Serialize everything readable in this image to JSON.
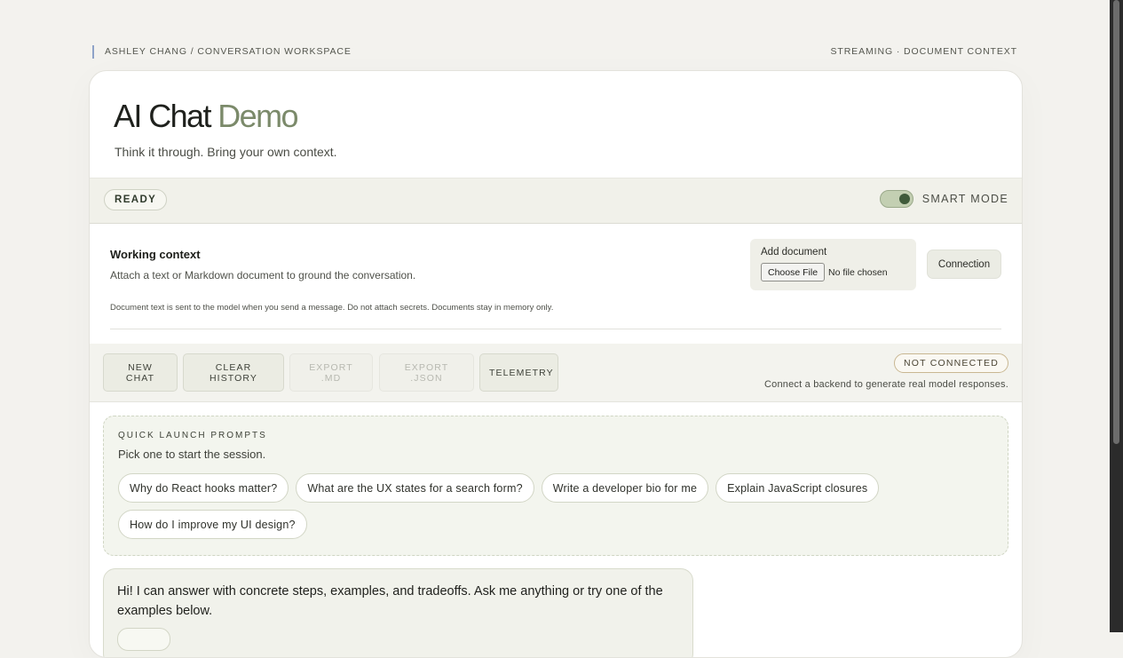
{
  "breadcrumb": {
    "text": "ASHLEY CHANG / CONVERSATION WORKSPACE"
  },
  "topbar": {
    "right_text": "STREAMING · DOCUMENT CONTEXT"
  },
  "hero": {
    "title_main": "AI Chat",
    "title_accent": "Demo",
    "subtitle": "Think it through. Bring your own context."
  },
  "status": {
    "ready_label": "READY",
    "smart_mode_label": "SMART MODE",
    "smart_mode_on": true
  },
  "context": {
    "title": "Working context",
    "description": "Attach a text or Markdown document to ground the conversation.",
    "note": "Document text is sent to the model when you send a message. Do not attach secrets. Documents stay in memory only.",
    "add_document_label": "Add document",
    "choose_file_label": "Choose File",
    "file_status": "No file chosen",
    "connection_button": "Connection"
  },
  "toolbar": {
    "new_chat": "NEW CHAT",
    "clear_history": "CLEAR HISTORY",
    "export_md": "EXPORT .MD",
    "export_json": "EXPORT .JSON",
    "telemetry": "TELEMETRY",
    "connection_status": "NOT CONNECTED",
    "connection_message": "Connect a backend to generate real model responses."
  },
  "quick_launch": {
    "label": "QUICK LAUNCH PROMPTS",
    "subtitle": "Pick one to start the session.",
    "prompts": [
      "Why do React hooks matter?",
      "What are the UX states for a search form?",
      "Write a developer bio for me",
      "Explain JavaScript closures",
      "How do I improve my UI design?"
    ]
  },
  "messages": [
    {
      "role": "assistant",
      "text": "Hi! I can answer with concrete steps, examples, and tradeoffs. Ask me anything or try one of the examples below."
    }
  ],
  "colors": {
    "accent": "#7b8a6a",
    "page_bg": "#f3f2ee",
    "toggle_on": "#3f5a3a",
    "warning_border": "#c9b792"
  }
}
